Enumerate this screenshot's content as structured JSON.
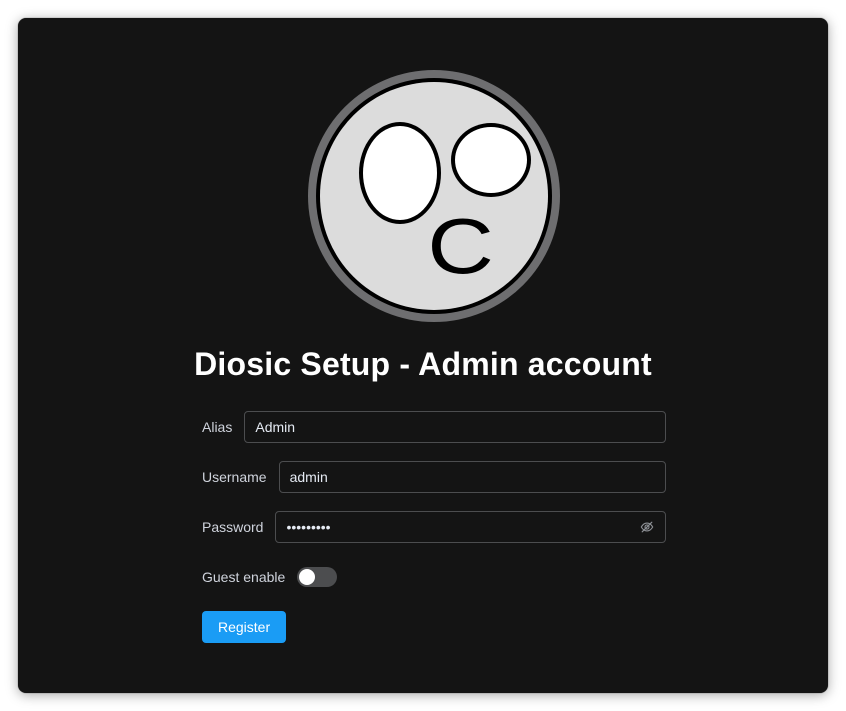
{
  "page": {
    "title": "Diosic Setup - Admin account"
  },
  "form": {
    "alias": {
      "label": "Alias",
      "value": "Admin"
    },
    "username": {
      "label": "Username",
      "value": "admin"
    },
    "password": {
      "label": "Password",
      "value": "123456789",
      "masked": true,
      "toggle_icon": "eye-off-icon"
    },
    "guest": {
      "label": "Guest enable",
      "enabled": false
    },
    "submit_label": "Register"
  },
  "colors": {
    "background": "#141414",
    "accent": "#1a9cf5",
    "border": "#4c4d4f",
    "text": "#cfd3dc"
  },
  "logo": {
    "icon": "diosic-face-logo-icon",
    "glyph": "C"
  }
}
